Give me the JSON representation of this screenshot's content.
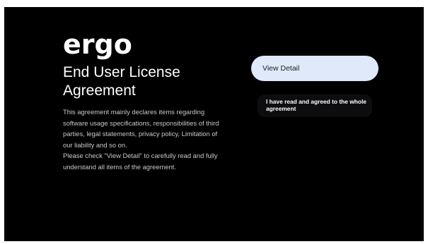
{
  "brand": {
    "logo_text": "ergo"
  },
  "page": {
    "title": "End User License Agreement",
    "description_lines": [
      "This agreement mainly declares items regarding software usage specifications, responsibilities of third parties, legal statements, privacy policy, Limitation of our liability and so on.",
      "Please check \"View Detail\" to carefully read and fully understand all items of the agreement."
    ]
  },
  "actions": {
    "view_detail_label": "View Detail",
    "agree_label": "I have read and agreed to the whole agreement"
  },
  "colors": {
    "background": "#000000",
    "focused_button": "#dfe9f9",
    "secondary_button": "#0d0d0f"
  }
}
